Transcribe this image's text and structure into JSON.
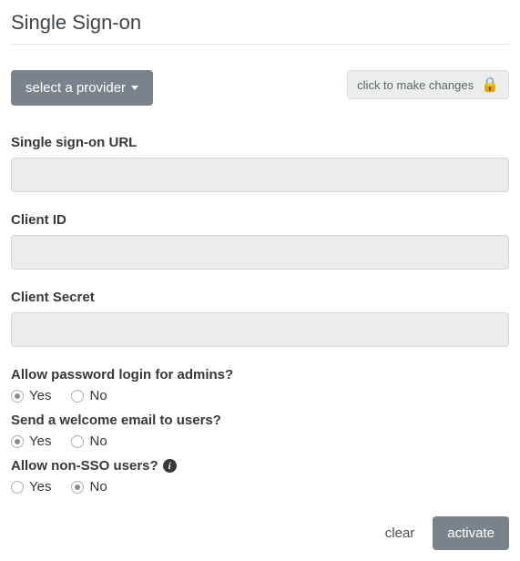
{
  "header": {
    "title": "Single Sign-on"
  },
  "top": {
    "provider_button": "select a provider",
    "lock_badge": "click to make changes"
  },
  "fields": {
    "sso_url": {
      "label": "Single sign-on URL",
      "value": ""
    },
    "client_id": {
      "label": "Client ID",
      "value": ""
    },
    "client_secret": {
      "label": "Client Secret",
      "value": ""
    }
  },
  "radios": {
    "allow_password_admins": {
      "label": "Allow password login for admins?",
      "yes": "Yes",
      "no": "No",
      "selected": "yes"
    },
    "send_welcome": {
      "label": "Send a welcome email to users?",
      "yes": "Yes",
      "no": "No",
      "selected": "yes"
    },
    "allow_non_sso": {
      "label": "Allow non-SSO users?",
      "yes": "Yes",
      "no": "No",
      "selected": "no"
    }
  },
  "footer": {
    "clear": "clear",
    "activate": "activate"
  }
}
